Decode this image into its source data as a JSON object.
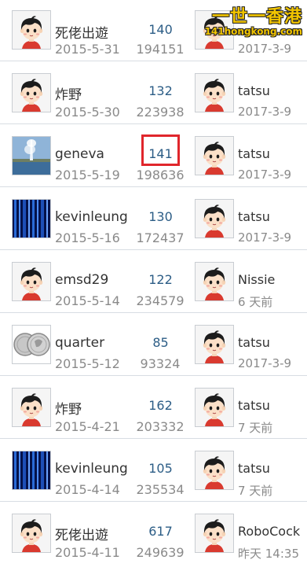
{
  "watermark": {
    "title": "一世一香港",
    "site": "141hongkong.com"
  },
  "rows": [
    {
      "author": "死佬出遊",
      "date": "2015-5-31",
      "replies": "140",
      "views": "194151",
      "last_user": "",
      "last_date": "2017-3-9",
      "author_avatar": "boy-avatar-icon",
      "last_avatar": "boy-avatar-icon"
    },
    {
      "author": "炸野",
      "date": "2015-5-30",
      "replies": "132",
      "views": "223938",
      "last_user": "tatsu",
      "last_date": "2017-3-9",
      "author_avatar": "boy-avatar-icon",
      "last_avatar": "boy-avatar-icon"
    },
    {
      "author": "geneva",
      "date": "2015-5-19",
      "replies": "141",
      "views": "198636",
      "last_user": "tatsu",
      "last_date": "2017-3-9",
      "author_avatar": "fountain-photo-icon",
      "last_avatar": "boy-avatar-icon"
    },
    {
      "author": "kevinleung",
      "date": "2015-5-16",
      "replies": "130",
      "views": "172437",
      "last_user": "tatsu",
      "last_date": "2017-3-9",
      "author_avatar": "blue-stripes-icon",
      "last_avatar": "boy-avatar-icon"
    },
    {
      "author": "emsd29",
      "date": "2015-5-14",
      "replies": "122",
      "views": "234579",
      "last_user": "Nissie",
      "last_date": "6 天前",
      "author_avatar": "boy-avatar-icon",
      "last_avatar": "boy-avatar-icon"
    },
    {
      "author": "quarter",
      "date": "2015-5-12",
      "replies": "85",
      "views": "93324",
      "last_user": "tatsu",
      "last_date": "2017-3-9",
      "author_avatar": "coins-photo-icon",
      "last_avatar": "boy-avatar-icon"
    },
    {
      "author": "炸野",
      "date": "2015-4-21",
      "replies": "162",
      "views": "203332",
      "last_user": "tatsu",
      "last_date": "7 天前",
      "author_avatar": "boy-avatar-icon",
      "last_avatar": "boy-avatar-icon"
    },
    {
      "author": "kevinleung",
      "date": "2015-4-14",
      "replies": "105",
      "views": "235534",
      "last_user": "tatsu",
      "last_date": "7 天前",
      "author_avatar": "blue-stripes-icon",
      "last_avatar": "boy-avatar-icon"
    },
    {
      "author": "死佬出遊",
      "date": "2015-4-11",
      "replies": "617",
      "views": "249639",
      "last_user": "RoboCock",
      "last_date": "昨天 14:35",
      "author_avatar": "boy-avatar-icon",
      "last_avatar": "boy-avatar-icon"
    }
  ]
}
